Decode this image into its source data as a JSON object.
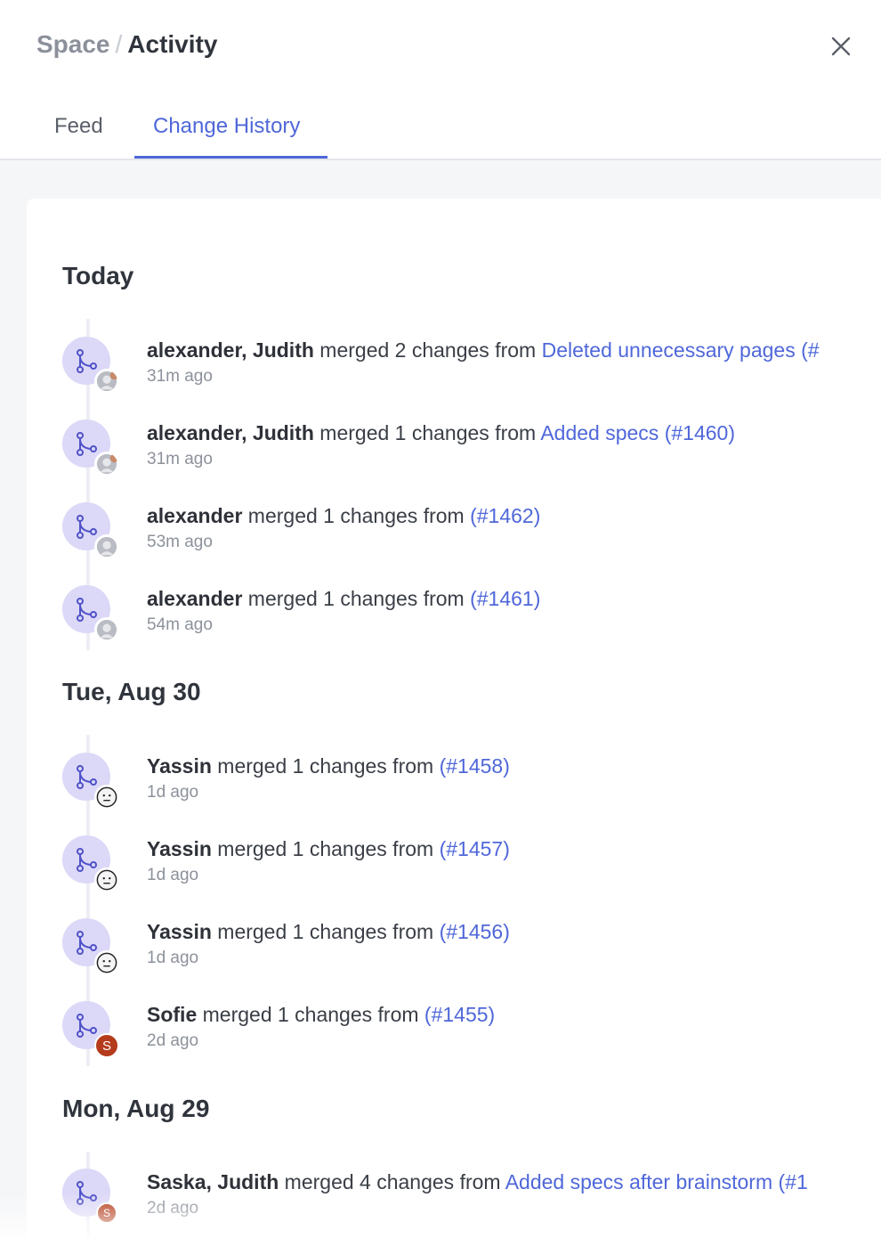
{
  "breadcrumb": {
    "root": "Space",
    "separator": "/",
    "current": "Activity"
  },
  "tabs": [
    {
      "label": "Feed",
      "active": false
    },
    {
      "label": "Change History",
      "active": true
    }
  ],
  "colors": {
    "accent": "#4f67d9",
    "avatar_bg": "#dcd8f7",
    "merge_icon": "#4f52c9",
    "sofie_avatar": "#b43b1b"
  },
  "sections": [
    {
      "title": "Today",
      "items": [
        {
          "users": "alexander, Judith",
          "action": "merged 2 changes from",
          "link": "Deleted unnecessary pages (#",
          "time": "31m ago",
          "avatar": "group-photo"
        },
        {
          "users": "alexander, Judith",
          "action": "merged 1 changes from",
          "link": "Added specs (#1460)",
          "time": "31m ago",
          "avatar": "group-photo"
        },
        {
          "users": "alexander",
          "action": "merged 1 changes from",
          "link": "(#1462)",
          "time": "53m ago",
          "avatar": "photo"
        },
        {
          "users": "alexander",
          "action": "merged 1 changes from",
          "link": "(#1461)",
          "time": "54m ago",
          "avatar": "photo"
        }
      ]
    },
    {
      "title": "Tue, Aug 30",
      "items": [
        {
          "users": "Yassin",
          "action": "merged 1 changes from",
          "link": "(#1458)",
          "time": "1d ago",
          "avatar": "face"
        },
        {
          "users": "Yassin",
          "action": "merged 1 changes from",
          "link": "(#1457)",
          "time": "1d ago",
          "avatar": "face"
        },
        {
          "users": "Yassin",
          "action": "merged 1 changes from",
          "link": "(#1456)",
          "time": "1d ago",
          "avatar": "face"
        },
        {
          "users": "Sofie",
          "action": "merged 1 changes from",
          "link": "(#1455)",
          "time": "2d ago",
          "avatar": "letter",
          "initial": "S"
        }
      ]
    },
    {
      "title": "Mon, Aug 29",
      "items": [
        {
          "users": "Saska, Judith",
          "action": "merged 4 changes from",
          "link": "Added specs after brainstorm (#1",
          "time": "2d ago",
          "avatar": "letter-group",
          "initial": "S"
        }
      ]
    }
  ]
}
